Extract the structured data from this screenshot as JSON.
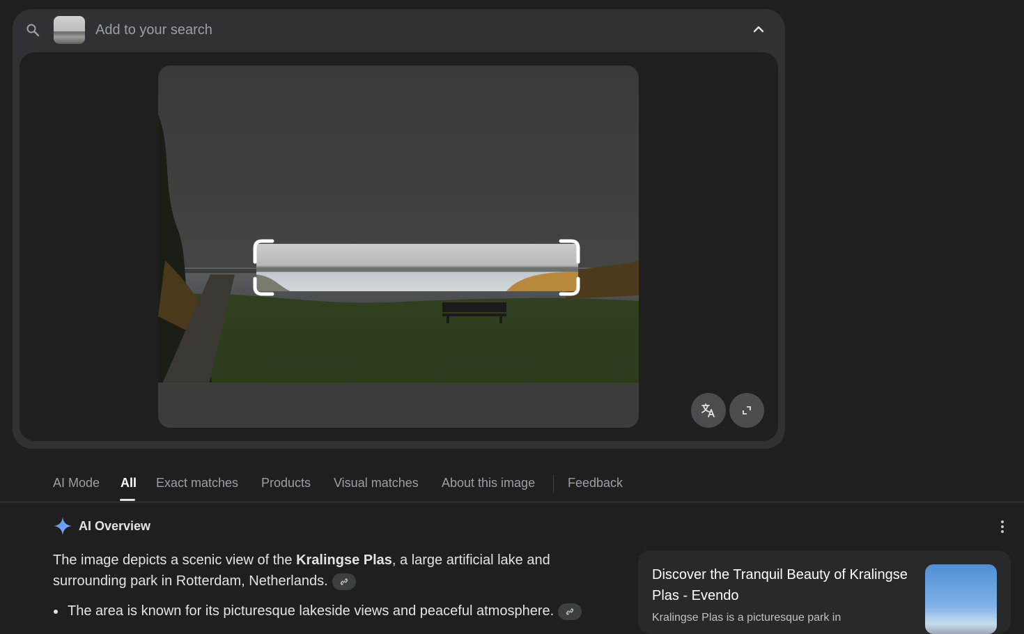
{
  "search": {
    "placeholder": "Add to your search",
    "search_icon": "search-icon",
    "collapse_icon": "chevron-up-icon"
  },
  "image_panel": {
    "translate_icon": "translate-icon",
    "fullscreen_icon": "fullscreen-icon"
  },
  "tabs": [
    {
      "label": "AI Mode",
      "active": false
    },
    {
      "label": "All",
      "active": true
    },
    {
      "label": "Exact matches",
      "active": false
    },
    {
      "label": "Products",
      "active": false
    },
    {
      "label": "Visual matches",
      "active": false
    },
    {
      "label": "About this image",
      "active": false
    },
    {
      "label": "Feedback",
      "active": false
    }
  ],
  "ai_overview": {
    "title": "AI Overview",
    "para_before": "The image depicts a scenic view of the ",
    "para_bold": "Kralingse Plas",
    "para_after": ", a large artificial lake and surrounding park in Rotterdam, Netherlands.",
    "bullet": "The area is known for its picturesque lakeside views and peaceful atmosphere."
  },
  "source_card": {
    "title": "Discover the Tranquil Beauty of Kralingse Plas - Evendo",
    "snippet": "Kralingse Plas is a picturesque park in"
  },
  "colors": {
    "background": "#1f1f1f",
    "card": "#303134",
    "accent_sparkle": "#4c8df6"
  }
}
